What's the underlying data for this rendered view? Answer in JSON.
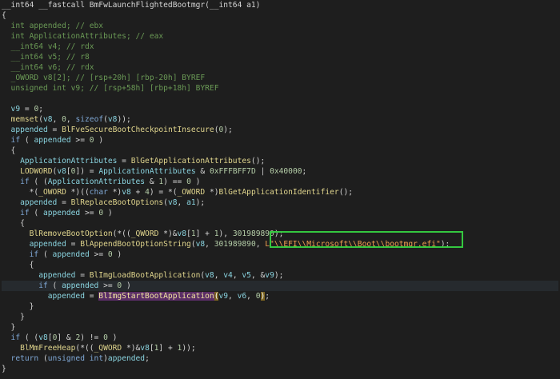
{
  "editor": {
    "lines": [
      [
        {
          "t": "__int64 __fastcall BmFwLaunchFlightedBootmgr(__int64 a1)",
          "c": "plain"
        }
      ],
      [
        {
          "t": "{",
          "c": "plain"
        }
      ],
      [
        {
          "t": "  int appended; // ebx",
          "c": "cmt"
        }
      ],
      [
        {
          "t": "  int ApplicationAttributes; // eax",
          "c": "cmt"
        }
      ],
      [
        {
          "t": "  __int64 v4; // rdx",
          "c": "cmt"
        }
      ],
      [
        {
          "t": "  __int64 v5; // r8",
          "c": "cmt"
        }
      ],
      [
        {
          "t": "  __int64 v6; // rdx",
          "c": "cmt"
        }
      ],
      [
        {
          "t": "  _OWORD v8[2]; // [rsp+20h] [rbp-20h] BYREF",
          "c": "cmt"
        }
      ],
      [
        {
          "t": "  unsigned int v9; // [rsp+58h] [rbp+18h] BYREF",
          "c": "cmt"
        }
      ],
      [
        {
          "t": "",
          "c": "plain"
        }
      ],
      [
        {
          "t": "  v9",
          "c": "var"
        },
        {
          "t": " = ",
          "c": "plain"
        },
        {
          "t": "0",
          "c": "num"
        },
        {
          "t": ";",
          "c": "plain"
        }
      ],
      [
        {
          "t": "  memset",
          "c": "func"
        },
        {
          "t": "(",
          "c": "plain"
        },
        {
          "t": "v8",
          "c": "var"
        },
        {
          "t": ", ",
          "c": "plain"
        },
        {
          "t": "0",
          "c": "num"
        },
        {
          "t": ", ",
          "c": "plain"
        },
        {
          "t": "sizeof",
          "c": "kw"
        },
        {
          "t": "(",
          "c": "plain"
        },
        {
          "t": "v8",
          "c": "var"
        },
        {
          "t": "));",
          "c": "plain"
        }
      ],
      [
        {
          "t": "  appended",
          "c": "var"
        },
        {
          "t": " = ",
          "c": "plain"
        },
        {
          "t": "BlFveSecureBootCheckpointInsecure",
          "c": "func"
        },
        {
          "t": "(",
          "c": "plain"
        },
        {
          "t": "0",
          "c": "num"
        },
        {
          "t": ");",
          "c": "plain"
        }
      ],
      [
        {
          "t": "  if",
          "c": "kw"
        },
        {
          "t": " ( ",
          "c": "plain"
        },
        {
          "t": "appended",
          "c": "var"
        },
        {
          "t": " >= ",
          "c": "plain"
        },
        {
          "t": "0",
          "c": "num"
        },
        {
          "t": " )",
          "c": "plain"
        }
      ],
      [
        {
          "t": "  {",
          "c": "plain"
        }
      ],
      [
        {
          "t": "    ApplicationAttributes",
          "c": "var"
        },
        {
          "t": " = ",
          "c": "plain"
        },
        {
          "t": "BlGetApplicationAttributes",
          "c": "func"
        },
        {
          "t": "();",
          "c": "plain"
        }
      ],
      [
        {
          "t": "    LODWORD",
          "c": "func"
        },
        {
          "t": "(",
          "c": "plain"
        },
        {
          "t": "v8",
          "c": "var"
        },
        {
          "t": "[",
          "c": "plain"
        },
        {
          "t": "0",
          "c": "num"
        },
        {
          "t": "]) = ",
          "c": "plain"
        },
        {
          "t": "ApplicationAttributes",
          "c": "var"
        },
        {
          "t": " & ",
          "c": "plain"
        },
        {
          "t": "0xFFFBFF7D",
          "c": "num"
        },
        {
          "t": " | ",
          "c": "plain"
        },
        {
          "t": "0x40000",
          "c": "num"
        },
        {
          "t": ";",
          "c": "plain"
        }
      ],
      [
        {
          "t": "    if",
          "c": "kw"
        },
        {
          "t": " ( (",
          "c": "plain"
        },
        {
          "t": "ApplicationAttributes",
          "c": "var"
        },
        {
          "t": " & ",
          "c": "plain"
        },
        {
          "t": "1",
          "c": "num"
        },
        {
          "t": ") == ",
          "c": "plain"
        },
        {
          "t": "0",
          "c": "num"
        },
        {
          "t": " )",
          "c": "plain"
        }
      ],
      [
        {
          "t": "      *(",
          "c": "plain"
        },
        {
          "t": "_OWORD",
          "c": "func"
        },
        {
          "t": " *)((",
          "c": "plain"
        },
        {
          "t": "char",
          "c": "kw"
        },
        {
          "t": " *)",
          "c": "plain"
        },
        {
          "t": "v8",
          "c": "var"
        },
        {
          "t": " + ",
          "c": "plain"
        },
        {
          "t": "4",
          "c": "num"
        },
        {
          "t": ") = *(",
          "c": "plain"
        },
        {
          "t": "_OWORD",
          "c": "func"
        },
        {
          "t": " *)",
          "c": "plain"
        },
        {
          "t": "BlGetApplicationIdentifier",
          "c": "func"
        },
        {
          "t": "();",
          "c": "plain"
        }
      ],
      [
        {
          "t": "    appended",
          "c": "var"
        },
        {
          "t": " = ",
          "c": "plain"
        },
        {
          "t": "BlReplaceBootOptions",
          "c": "func"
        },
        {
          "t": "(",
          "c": "plain"
        },
        {
          "t": "v8",
          "c": "var"
        },
        {
          "t": ", ",
          "c": "plain"
        },
        {
          "t": "a1",
          "c": "var"
        },
        {
          "t": ");",
          "c": "plain"
        }
      ],
      [
        {
          "t": "    if",
          "c": "kw"
        },
        {
          "t": " ( ",
          "c": "plain"
        },
        {
          "t": "appended",
          "c": "var"
        },
        {
          "t": " >= ",
          "c": "plain"
        },
        {
          "t": "0",
          "c": "num"
        },
        {
          "t": " )",
          "c": "plain"
        }
      ],
      [
        {
          "t": "    {",
          "c": "plain"
        }
      ],
      [
        {
          "t": "      BlRemoveBootOption",
          "c": "func"
        },
        {
          "t": "(*((",
          "c": "plain"
        },
        {
          "t": "_QWORD",
          "c": "func"
        },
        {
          "t": " *)&",
          "c": "plain"
        },
        {
          "t": "v8",
          "c": "var"
        },
        {
          "t": "[",
          "c": "plain"
        },
        {
          "t": "1",
          "c": "num"
        },
        {
          "t": "] + ",
          "c": "plain"
        },
        {
          "t": "1",
          "c": "num"
        },
        {
          "t": "), ",
          "c": "plain"
        },
        {
          "t": "301989890",
          "c": "num"
        },
        {
          "t": ");",
          "c": "plain"
        }
      ],
      [
        {
          "t": "      appended",
          "c": "var"
        },
        {
          "t": " = ",
          "c": "plain"
        },
        {
          "t": "BlAppendBootOptionString",
          "c": "func"
        },
        {
          "t": "(",
          "c": "plain"
        },
        {
          "t": "v8",
          "c": "var"
        },
        {
          "t": ", ",
          "c": "plain"
        },
        {
          "t": "301989890",
          "c": "num"
        },
        {
          "t": ", ",
          "c": "plain"
        },
        {
          "t": "L\"\\\\EFI\\\\Microsoft\\\\Boot\\\\bootmgr.efi\"",
          "c": "str"
        },
        {
          "t": ");",
          "c": "plain"
        }
      ],
      [
        {
          "t": "      if",
          "c": "kw"
        },
        {
          "t": " ( ",
          "c": "plain"
        },
        {
          "t": "appended",
          "c": "var"
        },
        {
          "t": " >= ",
          "c": "plain"
        },
        {
          "t": "0",
          "c": "num"
        },
        {
          "t": " )",
          "c": "plain"
        }
      ],
      [
        {
          "t": "      {",
          "c": "plain"
        }
      ],
      [
        {
          "t": "        appended",
          "c": "var"
        },
        {
          "t": " = ",
          "c": "plain"
        },
        {
          "t": "BlImgLoadBootApplication",
          "c": "func"
        },
        {
          "t": "(",
          "c": "plain"
        },
        {
          "t": "v8",
          "c": "var"
        },
        {
          "t": ", ",
          "c": "plain"
        },
        {
          "t": "v4",
          "c": "var"
        },
        {
          "t": ", ",
          "c": "plain"
        },
        {
          "t": "v5",
          "c": "var"
        },
        {
          "t": ", &",
          "c": "plain"
        },
        {
          "t": "v9",
          "c": "var"
        },
        {
          "t": ");",
          "c": "plain"
        }
      ],
      [
        {
          "t": "        if",
          "c": "kw"
        },
        {
          "t": " ( ",
          "c": "plain"
        },
        {
          "t": "appended",
          "c": "var"
        },
        {
          "t": " >= ",
          "c": "plain"
        },
        {
          "t": "0",
          "c": "num"
        },
        {
          "t": " )",
          "c": "plain"
        }
      ],
      [
        {
          "t": "          appended",
          "c": "var"
        },
        {
          "t": " = ",
          "c": "plain"
        },
        {
          "t": "BlImgStartBootApplication",
          "c": "hl"
        },
        {
          "t": "(",
          "c": "paren"
        },
        {
          "t": "v9",
          "c": "var"
        },
        {
          "t": ", ",
          "c": "plain"
        },
        {
          "t": "v6",
          "c": "var"
        },
        {
          "t": ", ",
          "c": "plain"
        },
        {
          "t": "0",
          "c": "num"
        },
        {
          "t": ")",
          "c": "paren"
        },
        {
          "t": ";",
          "c": "plain"
        }
      ],
      [
        {
          "t": "      }",
          "c": "plain"
        }
      ],
      [
        {
          "t": "    }",
          "c": "plain"
        }
      ],
      [
        {
          "t": "  }",
          "c": "plain"
        }
      ],
      [
        {
          "t": "  if",
          "c": "kw"
        },
        {
          "t": " ( (",
          "c": "plain"
        },
        {
          "t": "v8",
          "c": "var"
        },
        {
          "t": "[",
          "c": "plain"
        },
        {
          "t": "0",
          "c": "num"
        },
        {
          "t": "] & ",
          "c": "plain"
        },
        {
          "t": "2",
          "c": "num"
        },
        {
          "t": ") != ",
          "c": "plain"
        },
        {
          "t": "0",
          "c": "num"
        },
        {
          "t": " )",
          "c": "plain"
        }
      ],
      [
        {
          "t": "    BlMmFreeHeap",
          "c": "func"
        },
        {
          "t": "(*((",
          "c": "plain"
        },
        {
          "t": "_QWORD",
          "c": "func"
        },
        {
          "t": " *)&",
          "c": "plain"
        },
        {
          "t": "v8",
          "c": "var"
        },
        {
          "t": "[",
          "c": "plain"
        },
        {
          "t": "1",
          "c": "num"
        },
        {
          "t": "] + ",
          "c": "plain"
        },
        {
          "t": "1",
          "c": "num"
        },
        {
          "t": "));",
          "c": "plain"
        }
      ],
      [
        {
          "t": "  return",
          "c": "kw"
        },
        {
          "t": " (",
          "c": "plain"
        },
        {
          "t": "unsigned int",
          "c": "kw"
        },
        {
          "t": ")",
          "c": "plain"
        },
        {
          "t": "appended",
          "c": "var"
        },
        {
          "t": ";",
          "c": "plain"
        }
      ],
      [
        {
          "t": "}",
          "c": "plain"
        }
      ]
    ],
    "current_line_index": 27,
    "highlighted_string": "L\"\\\\EFI\\\\Microsoft\\\\Boot\\\\bootmgr.efi\"",
    "colors": {
      "background": "#1e1e1e",
      "highlight_box": "#34c840",
      "string": "#f0a050",
      "function": "#e0d58d",
      "variable": "#8ad4e0",
      "keyword": "#7fa8d6",
      "comment": "#6a9955",
      "selected_function_bg": "#5a2d66",
      "matching_paren_bg": "#7a6320"
    }
  }
}
